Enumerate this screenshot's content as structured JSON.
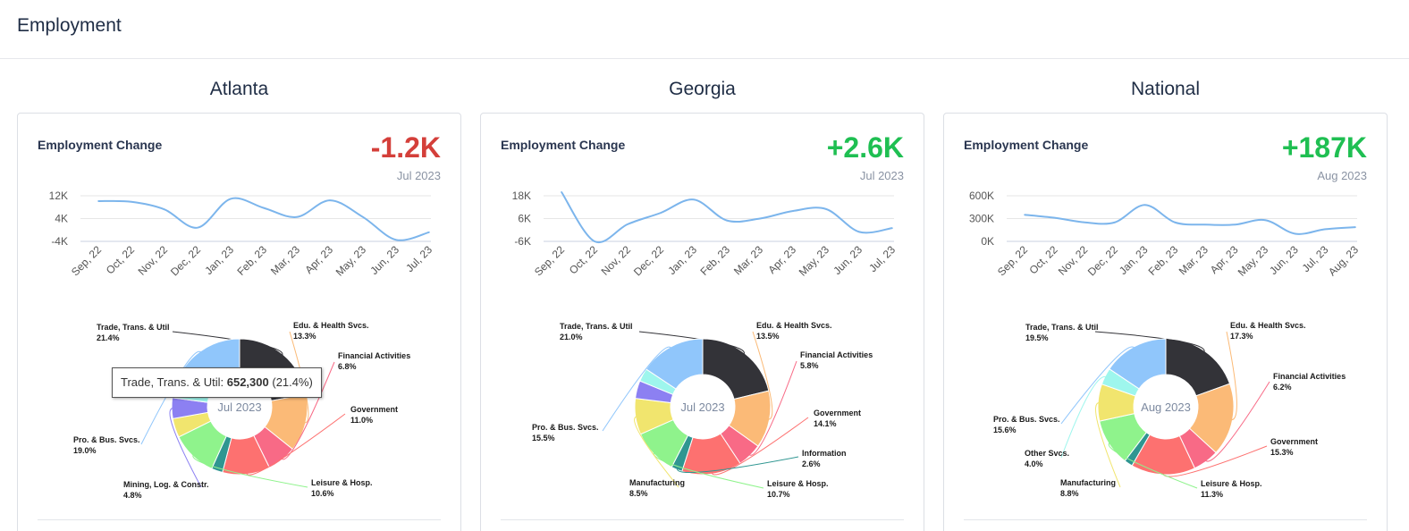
{
  "page": {
    "title": "Employment"
  },
  "colors": {
    "negative": "#d43f3a",
    "positive": "#1fbf52",
    "line": "#7cb5ec"
  },
  "regions": [
    {
      "name": "Atlanta",
      "card_label": "Employment Change",
      "value": "-1.2K",
      "sign": "neg",
      "date": "Jul 2023",
      "center_label": "Jul 2023",
      "tooltip": {
        "label": "Trade, Trans. & Util:",
        "value": "652,300",
        "pct": "(21.4%)"
      }
    },
    {
      "name": "Georgia",
      "card_label": "Employment Change",
      "value": "+2.6K",
      "sign": "pos",
      "date": "Jul 2023",
      "center_label": "Jul 2023"
    },
    {
      "name": "National",
      "card_label": "Employment Change",
      "value": "+187K",
      "sign": "pos",
      "date": "Aug 2023",
      "center_label": "Aug 2023"
    }
  ],
  "chart_data": [
    {
      "region": "Atlanta",
      "type": "line",
      "x": [
        "Sep, 22",
        "Oct, 22",
        "Nov, 22",
        "Dec, 22",
        "Jan, 23",
        "Feb, 23",
        "Mar, 23",
        "Apr, 23",
        "May, 23",
        "Jun, 23",
        "Jul, 23"
      ],
      "series": [
        {
          "values": [
            10.5,
            10,
            5,
            -7,
            12,
            6,
            0,
            11,
            0,
            -15,
            -10
          ]
        }
      ],
      "yticks": [
        "12K",
        "4K",
        "-4K"
      ],
      "ylim": [
        -16,
        14
      ],
      "grid": true
    },
    {
      "region": "Georgia",
      "type": "line",
      "x": [
        "Sep, 22",
        "Oct, 22",
        "Nov, 22",
        "Dec, 22",
        "Jan, 23",
        "Feb, 23",
        "Mar, 23",
        "Apr, 23",
        "May, 23",
        "Jun, 23",
        "Jul, 23"
      ],
      "series": [
        {
          "values": [
            20,
            -6,
            3,
            9,
            16,
            5,
            6,
            10,
            11,
            -1,
            1
          ]
        }
      ],
      "yticks": [
        "18K",
        "6K",
        "-6K"
      ],
      "ylim": [
        -6,
        18
      ],
      "grid": true
    },
    {
      "region": "National",
      "type": "line",
      "x": [
        "Sep, 22",
        "Oct, 22",
        "Nov, 22",
        "Dec, 22",
        "Jan, 23",
        "Feb, 23",
        "Mar, 23",
        "Apr, 23",
        "May, 23",
        "Jun, 23",
        "Jul, 23",
        "Aug, 23"
      ],
      "series": [
        {
          "values": [
            350,
            310,
            250,
            250,
            480,
            250,
            220,
            220,
            280,
            100,
            160,
            187
          ]
        }
      ],
      "yticks": [
        "600K",
        "300K",
        "0K"
      ],
      "ylim": [
        0,
        600
      ],
      "grid": true
    },
    {
      "region": "Atlanta",
      "type": "pie",
      "slices": [
        {
          "label": "Trade, Trans. & Util",
          "value": 21.4,
          "pct": "21.4%",
          "color": "#333338"
        },
        {
          "label": "Edu. & Health Svcs.",
          "value": 13.3,
          "pct": "13.3%",
          "color": "#fbba77"
        },
        {
          "label": "Financial Activities",
          "value": 6.8,
          "pct": "6.8%",
          "color": "#f86a86"
        },
        {
          "label": "Government",
          "value": 11.0,
          "pct": "11.0%",
          "color": "#fd7170"
        },
        {
          "label": "",
          "value": 2.6,
          "pct": "",
          "color": "#2f9691"
        },
        {
          "label": "Leisure & Hosp.",
          "value": 10.6,
          "pct": "10.6%",
          "color": "#8ff38c"
        },
        {
          "label": "",
          "value": 4.4,
          "pct": "",
          "color": "#f1e56e"
        },
        {
          "label": "Mining, Log. & Constr.",
          "value": 4.8,
          "pct": "4.8%",
          "color": "#8c80f2"
        },
        {
          "label": "",
          "value": 3.2,
          "pct": "",
          "color": "#9ef6ed"
        },
        {
          "label": "Pro. & Bus. Svcs.",
          "value": 19.0,
          "pct": "19.0%",
          "color": "#90c6fb"
        }
      ]
    },
    {
      "region": "Georgia",
      "type": "pie",
      "slices": [
        {
          "label": "Trade, Trans. & Util",
          "value": 21.0,
          "pct": "21.0%",
          "color": "#333338"
        },
        {
          "label": "Edu. & Health Svcs.",
          "value": 13.5,
          "pct": "13.5%",
          "color": "#fbba77"
        },
        {
          "label": "Financial Activities",
          "value": 5.8,
          "pct": "5.8%",
          "color": "#f86a86"
        },
        {
          "label": "Government",
          "value": 14.1,
          "pct": "14.1%",
          "color": "#fd7170"
        },
        {
          "label": "Information",
          "value": 2.6,
          "pct": "2.6%",
          "color": "#2f9691"
        },
        {
          "label": "Leisure & Hosp.",
          "value": 10.7,
          "pct": "10.7%",
          "color": "#8ff38c"
        },
        {
          "label": "Manufacturing",
          "value": 8.5,
          "pct": "8.5%",
          "color": "#f1e56e"
        },
        {
          "label": "",
          "value": 4.2,
          "pct": "",
          "color": "#8c80f2"
        },
        {
          "label": "",
          "value": 3.1,
          "pct": "",
          "color": "#9ef6ed"
        },
        {
          "label": "Pro. & Bus. Svcs.",
          "value": 15.5,
          "pct": "15.5%",
          "color": "#90c6fb"
        }
      ]
    },
    {
      "region": "National",
      "type": "pie",
      "slices": [
        {
          "label": "Trade, Trans. & Util",
          "value": 19.5,
          "pct": "19.5%",
          "color": "#333338"
        },
        {
          "label": "Edu. & Health Svcs.",
          "value": 17.3,
          "pct": "17.3%",
          "color": "#fbba77"
        },
        {
          "label": "Financial Activities",
          "value": 6.2,
          "pct": "6.2%",
          "color": "#f86a86"
        },
        {
          "label": "Government",
          "value": 15.3,
          "pct": "15.3%",
          "color": "#fd7170"
        },
        {
          "label": "",
          "value": 2.0,
          "pct": "",
          "color": "#2f9691"
        },
        {
          "label": "Leisure & Hosp.",
          "value": 11.3,
          "pct": "11.3%",
          "color": "#8ff38c"
        },
        {
          "label": "Manufacturing",
          "value": 8.8,
          "pct": "8.8%",
          "color": "#f1e56e"
        },
        {
          "label": "Other Svcs.",
          "value": 4.0,
          "pct": "4.0%",
          "color": "#9ef6ed"
        },
        {
          "label": "Pro. & Bus. Svcs.",
          "value": 15.6,
          "pct": "15.6%",
          "color": "#90c6fb"
        }
      ]
    }
  ]
}
